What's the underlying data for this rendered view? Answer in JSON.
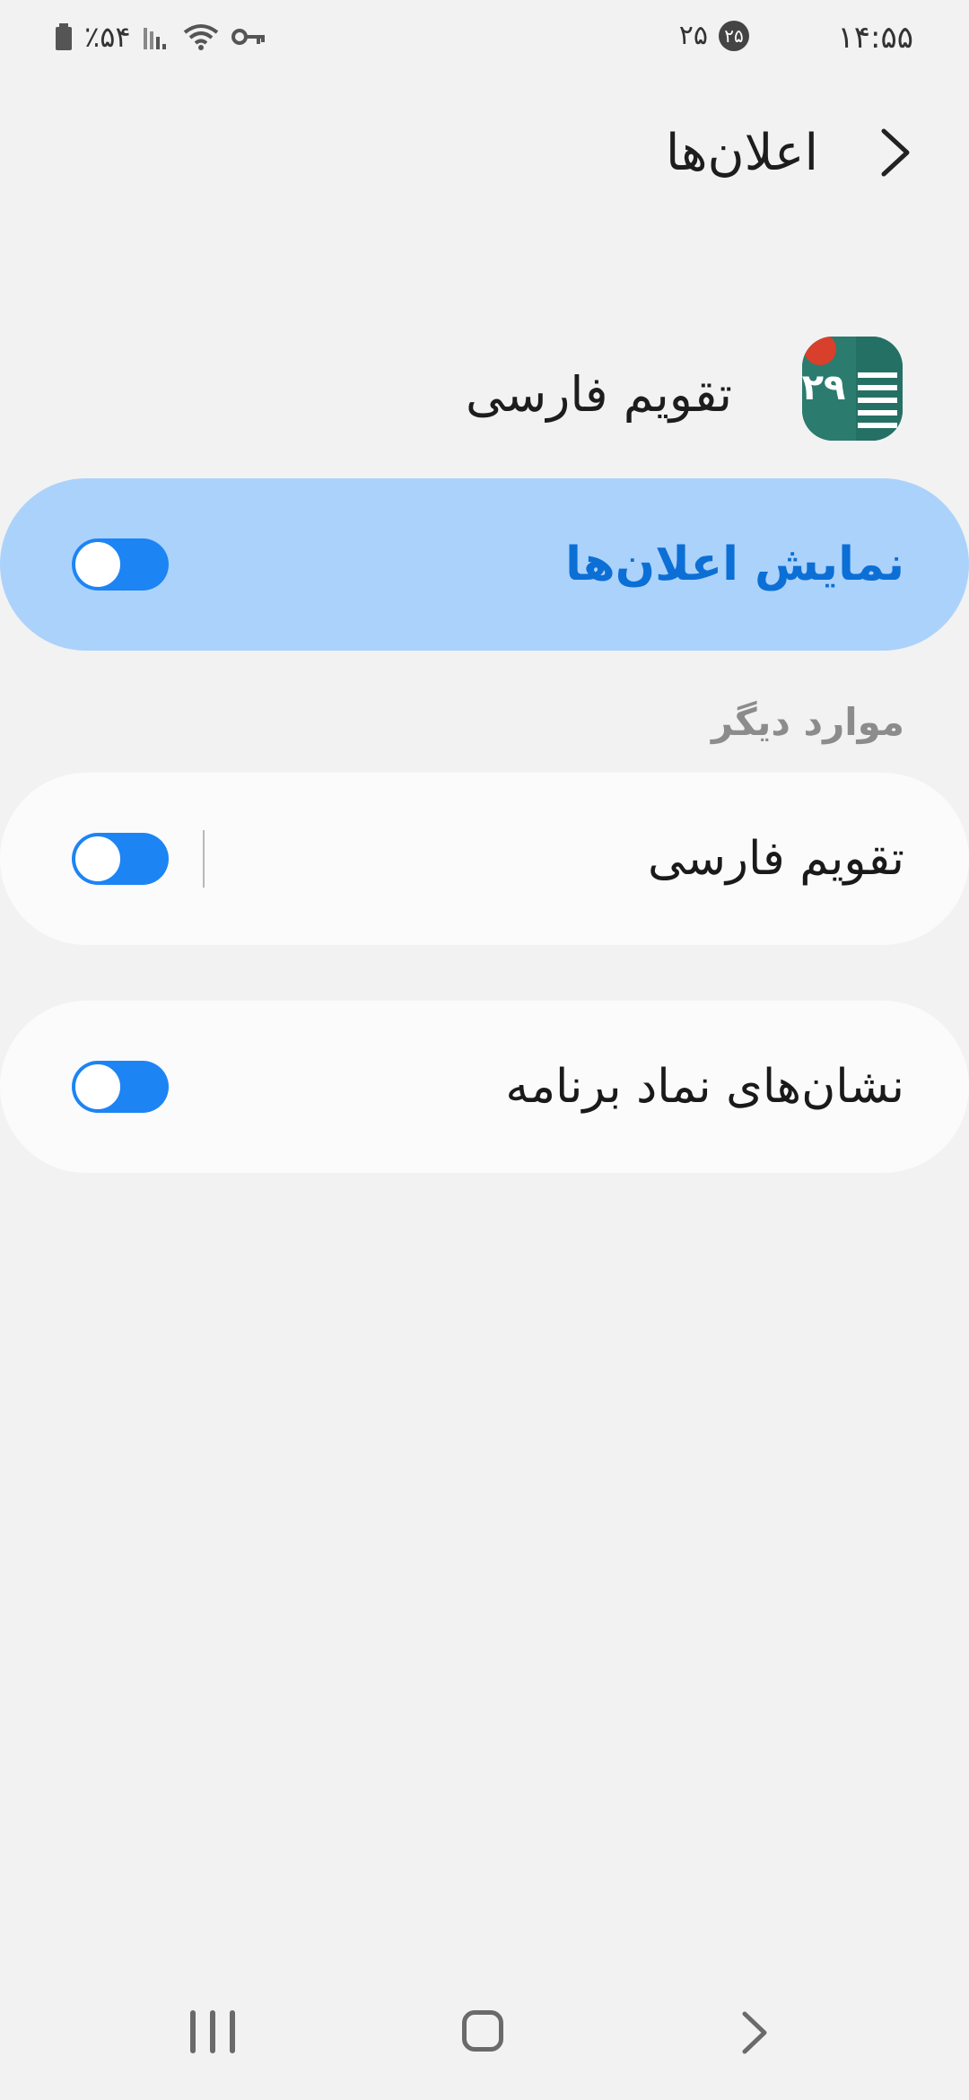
{
  "status_bar": {
    "time": "۱۴:۵۵",
    "badge_count": "۲۵",
    "date_number": "۲۵",
    "battery": "٪۵۴"
  },
  "header": {
    "title": "اعلان‌ها"
  },
  "app": {
    "name": "تقویم فارسی",
    "icon_text": "۲۹",
    "icon_color": "#2b7b6e"
  },
  "main_toggle": {
    "label": "نمایش اعلان‌ها",
    "state": "on"
  },
  "section": {
    "title": "موارد دیگر"
  },
  "items": [
    {
      "label": "تقویم فارسی",
      "state": "on"
    },
    {
      "label": "نشان‌های نماد برنامه",
      "state": "on"
    }
  ],
  "colors": {
    "accent": "#1d84f4",
    "highlight_card": "#abd2fb",
    "highlight_text": "#0c6fd6",
    "background": "#f2f2f2"
  }
}
